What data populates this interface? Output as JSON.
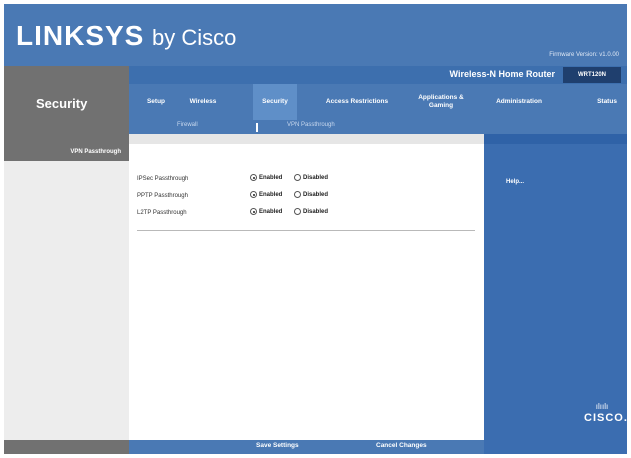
{
  "header": {
    "logo_main": "LINKSYS",
    "logo_by": "by Cisco",
    "firmware": "Firmware Version: v1.0.00"
  },
  "section_title": "Security",
  "product": {
    "name": "Wireless-N Home Router",
    "model": "WRT120N"
  },
  "tabs": [
    {
      "label": "Setup"
    },
    {
      "label": "Wireless"
    },
    {
      "label": "Security"
    },
    {
      "label": "Access Restrictions"
    },
    {
      "label": "Applications & Gaming"
    },
    {
      "label": "Administration"
    },
    {
      "label": "Status"
    }
  ],
  "active_tab": "Security",
  "subtabs": [
    {
      "label": "Firewall"
    },
    {
      "label": "VPN Passthrough"
    }
  ],
  "sidebar": {
    "items": [
      {
        "label": "VPN Passthrough"
      }
    ]
  },
  "content": {
    "rows": [
      {
        "label": "IPSec Passthrough",
        "enabled_label": "Enabled",
        "disabled_label": "Disabled",
        "value": "Enabled"
      },
      {
        "label": "PPTP Passthrough",
        "enabled_label": "Enabled",
        "disabled_label": "Disabled",
        "value": "Enabled"
      },
      {
        "label": "L2TP Passthrough",
        "enabled_label": "Enabled",
        "disabled_label": "Disabled",
        "value": "Enabled"
      }
    ]
  },
  "help": {
    "link": "Help..."
  },
  "footer": {
    "save_label": "Save Settings",
    "cancel_label": "Cancel Changes"
  },
  "brand": {
    "cisco_bars": "ılıılı",
    "cisco_word": "CISCO."
  },
  "colors": {
    "header_blue": "#4a79b4",
    "panel_blue": "#3b6db0",
    "gray": "#717171"
  }
}
